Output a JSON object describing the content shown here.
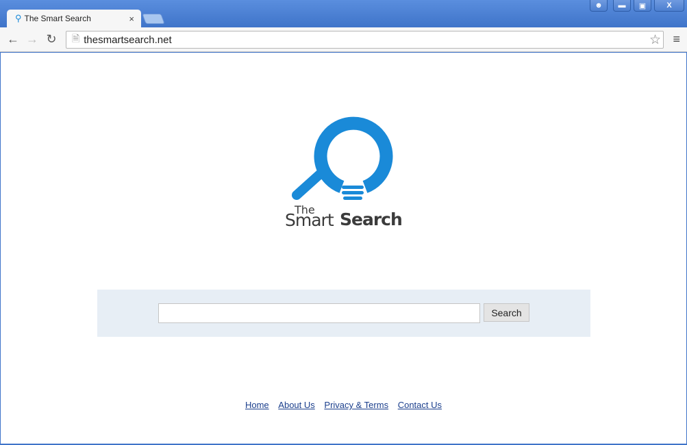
{
  "browser": {
    "tab_title": "The Smart Search",
    "url": "thesmartsearch.net"
  },
  "logo": {
    "line1": "The",
    "word1": "Smart",
    "word2": "Search",
    "color": "#1a8ad8"
  },
  "search": {
    "input_value": "",
    "button_label": "Search"
  },
  "footer": {
    "links": [
      "Home",
      "About Us",
      "Privacy & Terms",
      "Contact Us"
    ]
  }
}
